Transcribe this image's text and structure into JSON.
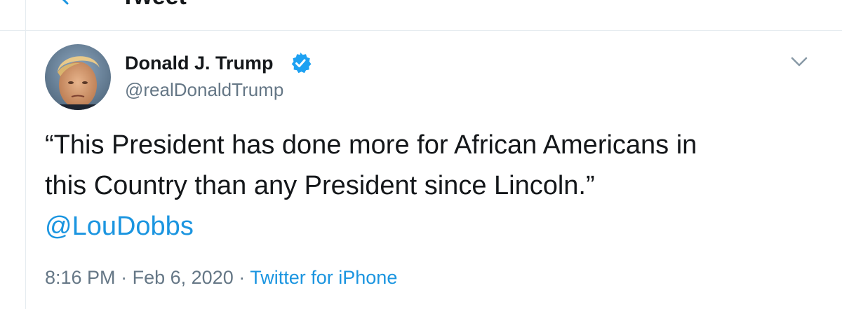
{
  "header": {
    "title": "Tweet",
    "back_icon": "arrow-left-icon"
  },
  "tweet": {
    "author": {
      "name": "Donald J. Trump",
      "handle": "@realDonaldTrump",
      "verified_icon": "verified-badge-icon",
      "avatar_icon": "avatar"
    },
    "text_lines": [
      "“This President has done more for African Americans in",
      "this Country than any President since Lincoln.”"
    ],
    "mention": "@LouDobbs",
    "time": "8:16 PM",
    "separator": "·",
    "date": "Feb 6, 2020",
    "source": "Twitter for iPhone",
    "menu_icon": "chevron-down-icon"
  },
  "colors": {
    "accent": "#1b95e0",
    "text": "#14171a",
    "secondary_text": "#657786",
    "border": "#e6ecf0"
  }
}
